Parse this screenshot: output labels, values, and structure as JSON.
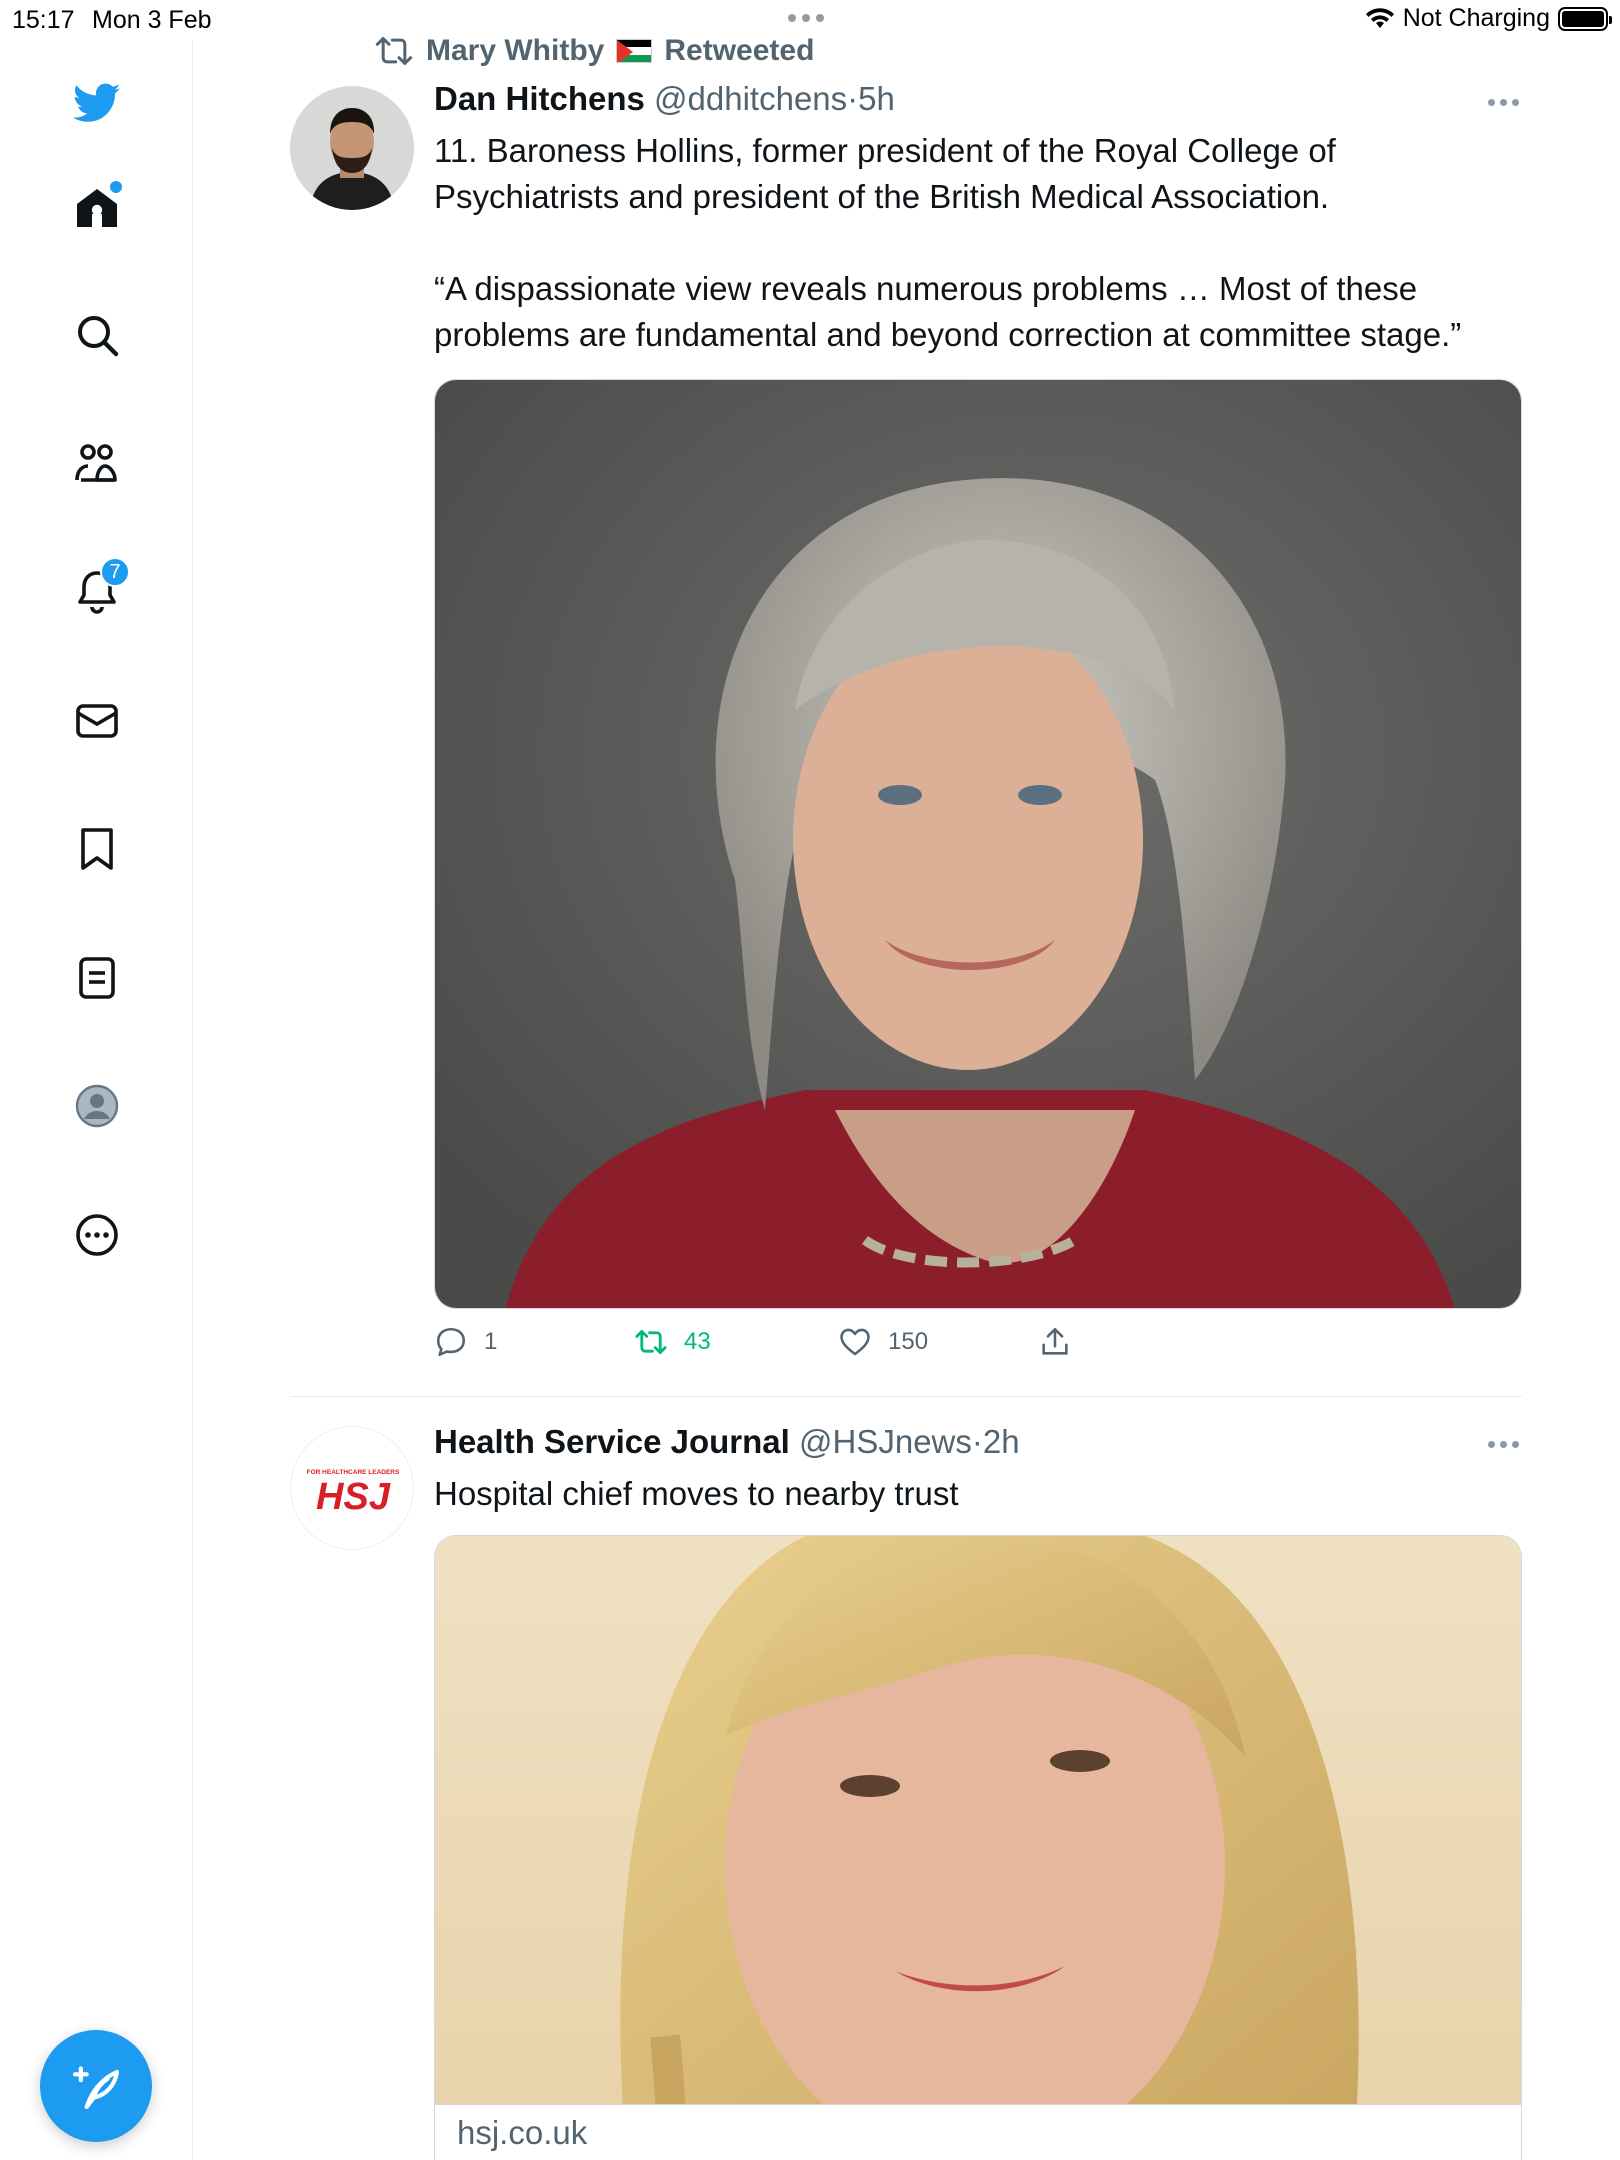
{
  "status_bar": {
    "time": "15:17",
    "date": "Mon 3 Feb",
    "charging": "Not Charging"
  },
  "sidebar": {
    "items": [
      {
        "name": "twitter-logo-icon"
      },
      {
        "name": "home-icon",
        "has_dot": true
      },
      {
        "name": "search-icon"
      },
      {
        "name": "communities-icon"
      },
      {
        "name": "notifications-icon",
        "badge": "7"
      },
      {
        "name": "messages-icon"
      },
      {
        "name": "bookmarks-icon"
      },
      {
        "name": "lists-icon"
      },
      {
        "name": "profile-icon"
      },
      {
        "name": "more-icon"
      }
    ],
    "compose_icon": "compose-tweet-icon"
  },
  "colors": {
    "accent": "#1d9bf0",
    "retweet_green": "#00ba7c",
    "secondary_text": "#536471"
  },
  "feed": {
    "retweet_context": {
      "retweeter": "Mary Whitby",
      "suffix": "Retweeted"
    },
    "tweets": [
      {
        "name": "Dan Hitchens",
        "handle": "@ddhitchens",
        "time": "5h",
        "separator": "·",
        "text": "11. Baroness Hollins, former president of the Royal College of Psychiatrists and president of the British Medical Association.\n\n“A dispassionate view reveals numerous problems … Most of these problems are fundamental and beyond correction at committee stage.”",
        "media_alt": "Portrait of Baroness Hollins",
        "replies": "1",
        "retweets": "43",
        "likes": "150"
      },
      {
        "name": "Health Service Journal",
        "handle": "@HSJnews",
        "time": "2h",
        "separator": "·",
        "text": "Hospital chief moves to nearby trust",
        "avatar_logo_text": "HSJ",
        "avatar_logo_tagline": "FOR HEALTHCARE LEADERS",
        "card_domain": "hsj.co.uk"
      }
    ]
  }
}
